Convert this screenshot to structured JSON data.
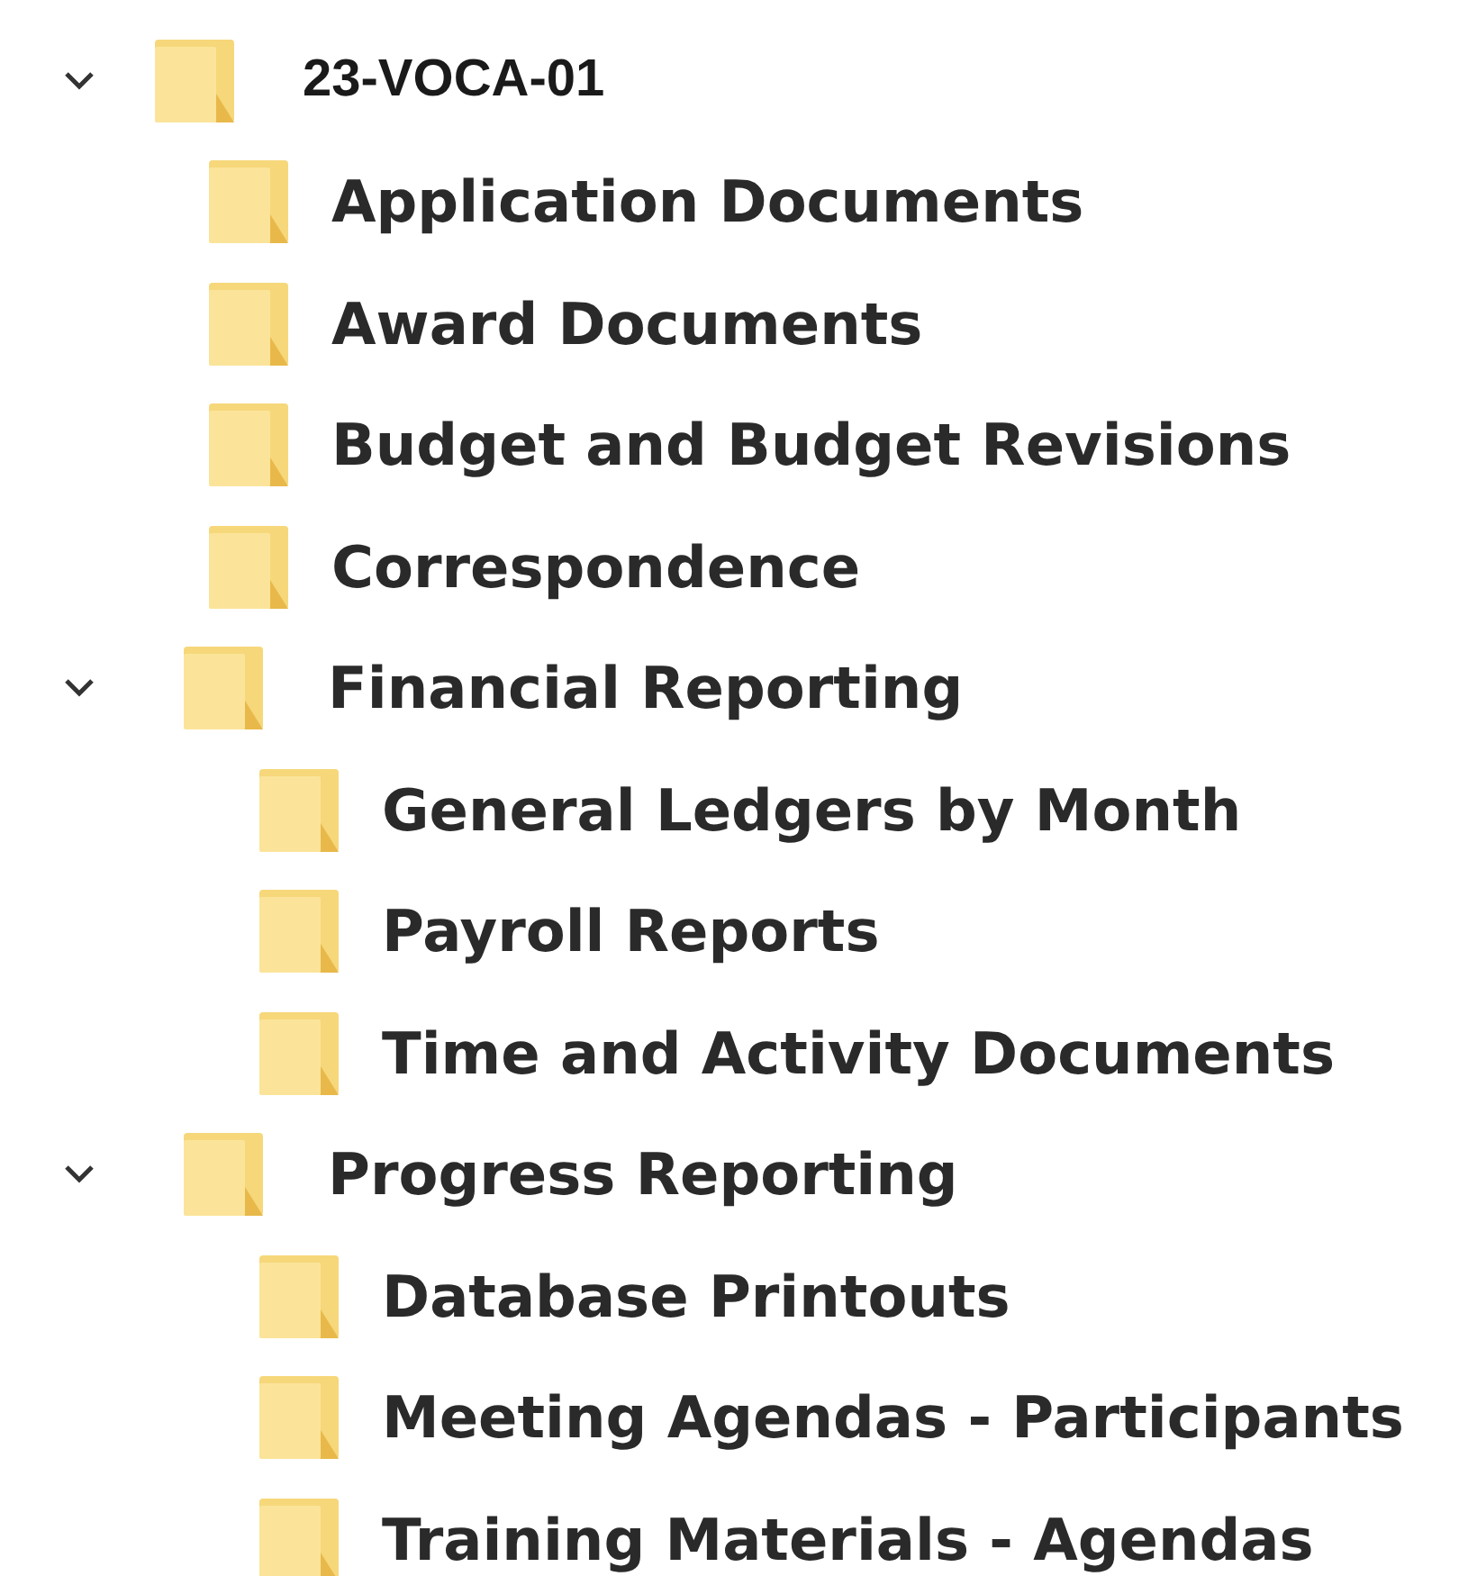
{
  "tree": [
    {
      "label": "23-VOCA-01",
      "kind": "root",
      "expanded": true,
      "children": [
        {
          "label": "Application Documents"
        },
        {
          "label": "Award Documents"
        },
        {
          "label": "Budget and Budget Revisions"
        },
        {
          "label": "Correspondence"
        },
        {
          "label": "Financial Reporting",
          "expanded": true,
          "children": [
            {
              "label": "General Ledgers by Month"
            },
            {
              "label": "Payroll Reports"
            },
            {
              "label": "Time and Activity Documents"
            }
          ]
        },
        {
          "label": "Progress Reporting",
          "expanded": true,
          "children": [
            {
              "label": "Database Printouts"
            },
            {
              "label": "Meeting Agendas - Participants"
            },
            {
              "label": "Training Materials - Agendas"
            }
          ]
        }
      ]
    }
  ]
}
